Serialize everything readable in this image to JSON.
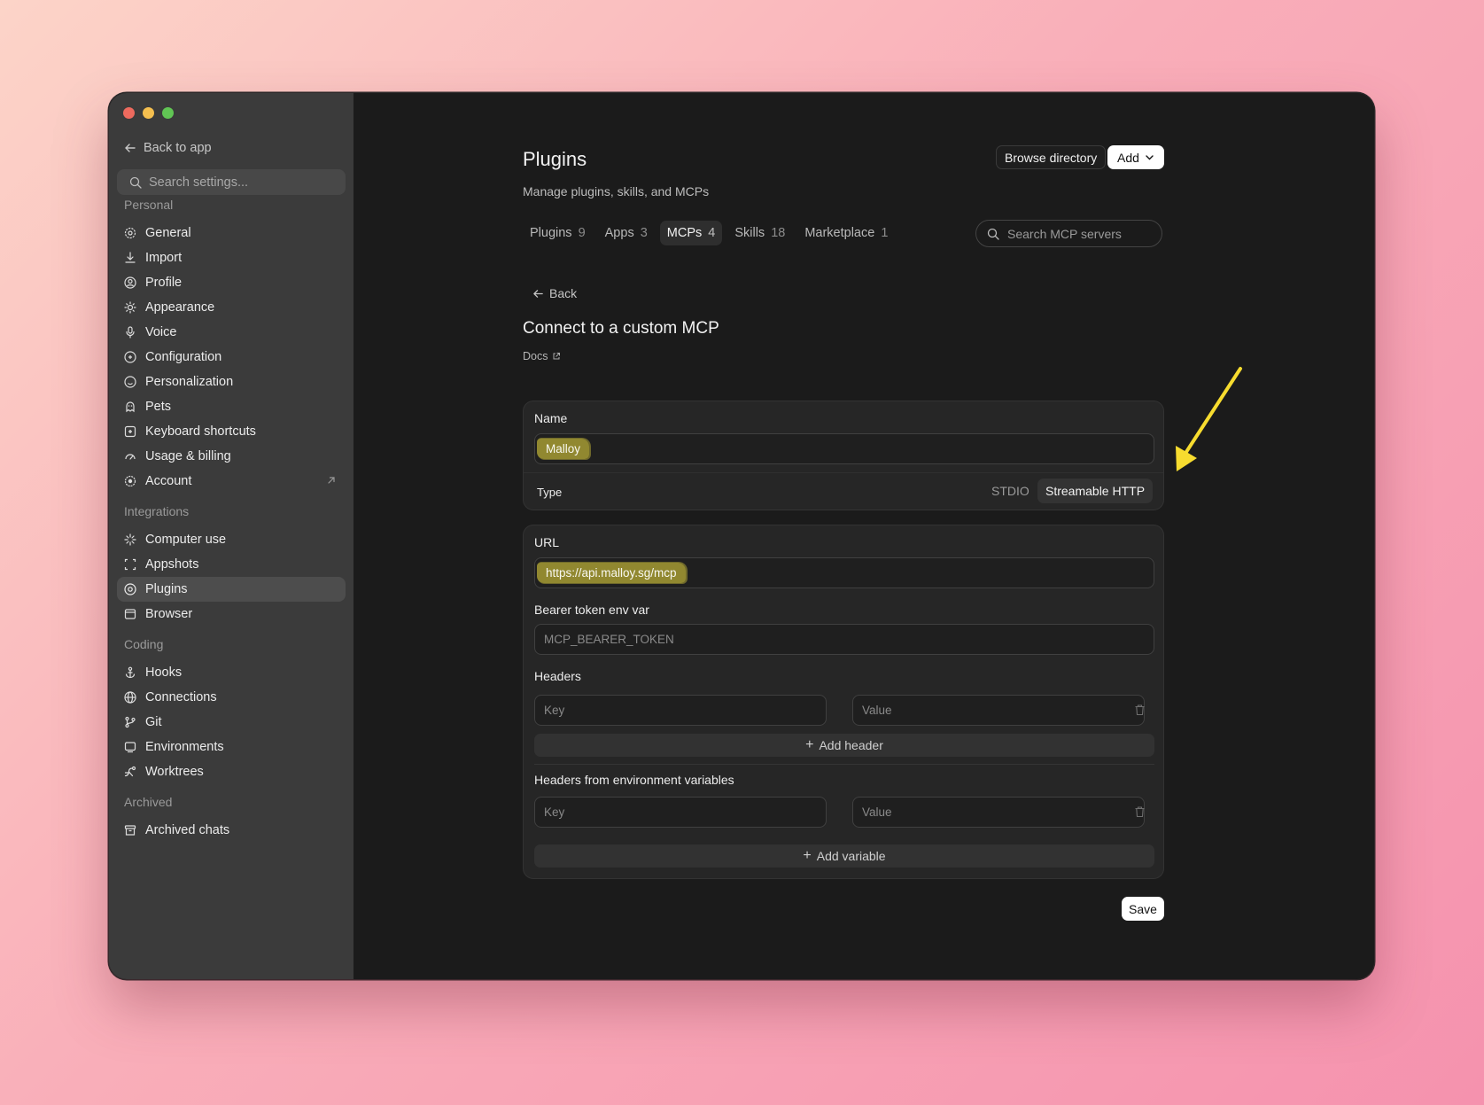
{
  "sidebar": {
    "back_label": "Back to app",
    "search_placeholder": "Search settings...",
    "sections": {
      "personal": "Personal",
      "integrations": "Integrations",
      "coding": "Coding",
      "archived": "Archived"
    },
    "items": {
      "general": "General",
      "import": "Import",
      "profile": "Profile",
      "appearance": "Appearance",
      "voice": "Voice",
      "configuration": "Configuration",
      "personalization": "Personalization",
      "pets": "Pets",
      "keyboard": "Keyboard shortcuts",
      "usage": "Usage & billing",
      "account": "Account",
      "computer_use": "Computer use",
      "appshots": "Appshots",
      "plugins": "Plugins",
      "browser": "Browser",
      "hooks": "Hooks",
      "connections": "Connections",
      "git": "Git",
      "environments": "Environments",
      "worktrees": "Worktrees",
      "archived_chats": "Archived chats"
    }
  },
  "header": {
    "title": "Plugins",
    "subtitle": "Manage plugins, skills, and MCPs",
    "browse_label": "Browse directory",
    "add_label": "Add"
  },
  "tabs": [
    {
      "label": "Plugins",
      "count": "9"
    },
    {
      "label": "Apps",
      "count": "3"
    },
    {
      "label": "MCPs",
      "count": "4"
    },
    {
      "label": "Skills",
      "count": "18"
    },
    {
      "label": "Marketplace",
      "count": "1"
    }
  ],
  "search_mcp_placeholder": "Search MCP servers",
  "form": {
    "back_label": "Back",
    "title": "Connect to a custom MCP",
    "docs_label": "Docs",
    "name_label": "Name",
    "name_value": "Malloy",
    "type_label": "Type",
    "type_options": [
      "STDIO",
      "Streamable HTTP"
    ],
    "type_selected": "Streamable HTTP",
    "url_label": "URL",
    "url_value": "https://api.malloy.sg/mcp",
    "bearer_label": "Bearer token env var",
    "bearer_placeholder": "MCP_BEARER_TOKEN",
    "headers_label": "Headers",
    "key_placeholder": "Key",
    "value_placeholder": "Value",
    "add_header_label": "Add header",
    "env_headers_label": "Headers from environment variables",
    "add_variable_label": "Add variable",
    "save_label": "Save"
  },
  "colors": {
    "highlight": "#bdb237",
    "annotation_arrow": "#f7dc2f",
    "accent_button": "#ffffff"
  }
}
